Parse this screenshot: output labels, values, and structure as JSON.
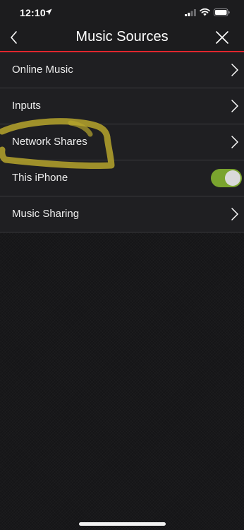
{
  "status_bar": {
    "time": "12:10",
    "location_icon": "location-arrow-icon",
    "signal_icon": "cellular-signal-icon",
    "wifi_icon": "wifi-icon",
    "battery_icon": "battery-icon"
  },
  "nav": {
    "title": "Music Sources",
    "back_icon": "chevron-left-icon",
    "close_icon": "close-icon"
  },
  "list": {
    "items": [
      {
        "label": "Online Music",
        "control": "chevron-right-icon"
      },
      {
        "label": "Inputs",
        "control": "chevron-right-icon"
      },
      {
        "label": "Network Shares",
        "control": "chevron-right-icon"
      },
      {
        "label": "This iPhone",
        "control": "toggle",
        "toggle_on": true
      },
      {
        "label": "Music Sharing",
        "control": "chevron-right-icon"
      }
    ]
  },
  "colors": {
    "accent_red": "#e0262d",
    "toggle_green": "#7aa42e",
    "highlighter_yellow": "#b6a52c",
    "background": "#151517",
    "row_background": "#1f1f22"
  }
}
